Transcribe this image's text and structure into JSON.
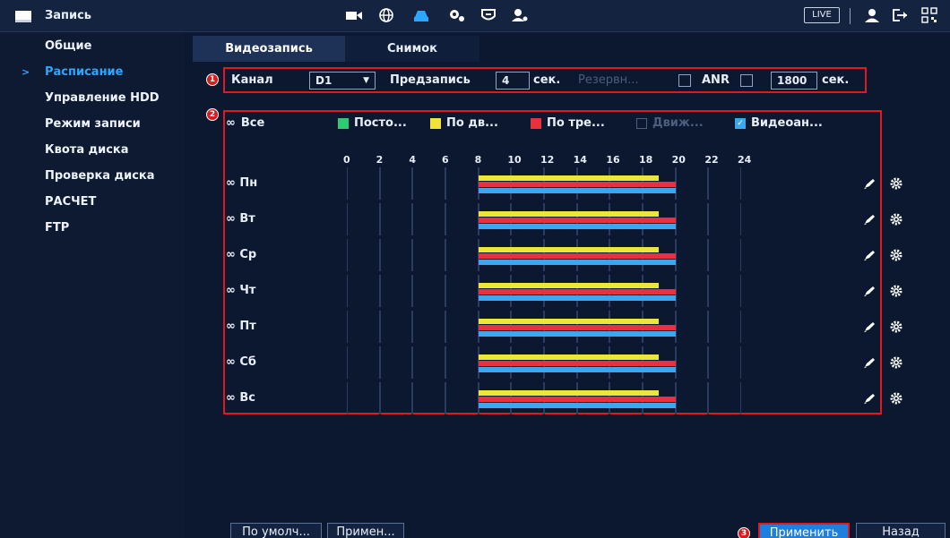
{
  "header": {
    "title": "Запись",
    "live_label": "LIVE"
  },
  "sidebar": {
    "items": [
      {
        "label": "Общие"
      },
      {
        "label": "Расписание"
      },
      {
        "label": "Управление HDD"
      },
      {
        "label": "Режим записи"
      },
      {
        "label": "Квота диска"
      },
      {
        "label": "Проверка диска"
      },
      {
        "label": "РАСЧЕТ"
      },
      {
        "label": "FTP"
      }
    ]
  },
  "tabs": [
    {
      "label": "Видеозапись"
    },
    {
      "label": "Снимок"
    }
  ],
  "controls": {
    "badge1": "1",
    "channel_label": "Канал",
    "channel_value": "D1",
    "prerecord_label": "Предзапись",
    "prerecord_value": "4",
    "prerecord_unit": "сек.",
    "reserve_label": "Резервн...",
    "anr_label": "ANR",
    "anr_value": "1800",
    "anr_unit": "сек."
  },
  "schedule": {
    "badge2": "2",
    "all_label": "Все",
    "legend": [
      {
        "label": "Посто...",
        "color": "#2ecc71",
        "enabled": true
      },
      {
        "label": "По дв...",
        "color": "#f2e33b",
        "enabled": true
      },
      {
        "label": "По тре...",
        "color": "#e8313a",
        "enabled": true
      },
      {
        "label": "Движ...",
        "color": "#0b1830",
        "enabled": false
      },
      {
        "label": "Видеоан...",
        "color": "#3aa7f0",
        "enabled": true,
        "checked": true
      }
    ],
    "hours": [
      "0",
      "2",
      "4",
      "6",
      "8",
      "10",
      "12",
      "14",
      "16",
      "18",
      "20",
      "22",
      "24"
    ],
    "days": [
      "Пн",
      "Вт",
      "Ср",
      "Чт",
      "Пт",
      "Сб",
      "Вс"
    ],
    "periods": [
      {
        "type": "По дв...",
        "color": "#f2e33b",
        "start": 8,
        "end": 19
      },
      {
        "type": "По тре...",
        "color": "#e8313a",
        "start": 8,
        "end": 20
      },
      {
        "type": "Видеоан...",
        "color": "#3aa7f0",
        "start": 8,
        "end": 20
      }
    ]
  },
  "footer": {
    "default_label": "По умолч...",
    "copy_label": "Примен...",
    "badge3": "3",
    "apply_label": "Применить",
    "back_label": "Назад"
  }
}
